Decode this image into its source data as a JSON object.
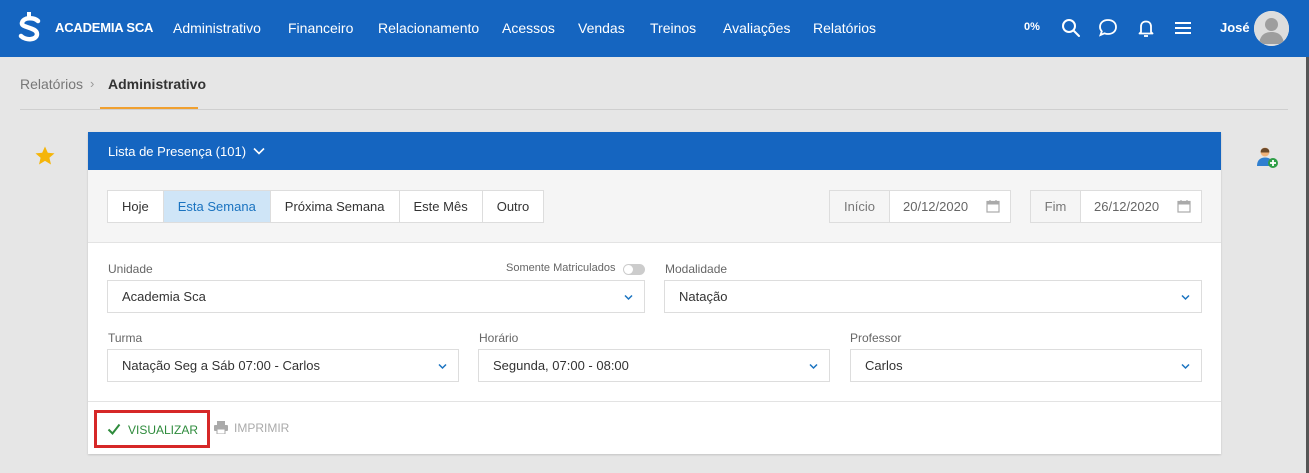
{
  "app": {
    "brand": "ACADEMIA SCA",
    "progress_label": "0%",
    "user_name": "José",
    "brand_color": "#1565c0"
  },
  "nav": {
    "items": [
      {
        "label": "Administrativo"
      },
      {
        "label": "Financeiro"
      },
      {
        "label": "Relacionamento"
      },
      {
        "label": "Acessos"
      },
      {
        "label": "Vendas"
      },
      {
        "label": "Treinos"
      },
      {
        "label": "Avaliações"
      },
      {
        "label": "Relatórios"
      }
    ],
    "icons": [
      "search-icon",
      "chat-icon",
      "bell-icon",
      "menu-icon"
    ]
  },
  "breadcrumb": {
    "parent": "Relatórios",
    "separator": "›",
    "current": "Administrativo"
  },
  "report": {
    "title": "Lista de Presença (101)",
    "periods": [
      {
        "label": "Hoje",
        "active": false
      },
      {
        "label": "Esta Semana",
        "active": true
      },
      {
        "label": "Próxima Semana",
        "active": false
      },
      {
        "label": "Este Mês",
        "active": false
      },
      {
        "label": "Outro",
        "active": false
      }
    ],
    "start": {
      "label": "Início",
      "value": "20/12/2020"
    },
    "end": {
      "label": "Fim",
      "value": "26/12/2020"
    }
  },
  "filters": {
    "unidade": {
      "label": "Unidade",
      "value": "Academia Sca"
    },
    "somente_matriculados": {
      "label": "Somente Matriculados",
      "checked": false
    },
    "modalidade": {
      "label": "Modalidade",
      "value": "Natação"
    },
    "turma": {
      "label": "Turma",
      "value": "Natação Seg a Sáb 07:00 - Carlos"
    },
    "horario": {
      "label": "Horário",
      "value": "Segunda, 07:00 - 08:00"
    },
    "professor": {
      "label": "Professor",
      "value": "Carlos"
    }
  },
  "actions": {
    "visualizar": "VISUALIZAR",
    "imprimir": "IMPRIMIR",
    "highlight_color": "#d62828",
    "success_color": "#2e8b3c"
  }
}
